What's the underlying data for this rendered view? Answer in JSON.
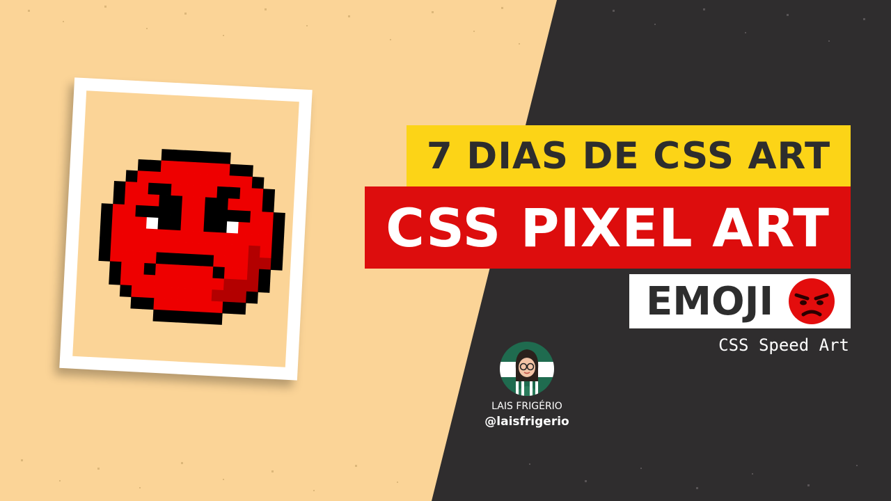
{
  "banner": {
    "series_title": "7 DIAS DE CSS ART",
    "main_title": "CSS PIXEL ART",
    "topic": "EMOJI",
    "subtitle": "CSS Speed Art"
  },
  "author": {
    "name": "LAIS FRIGÉRIO",
    "handle": "@laisfrigerio"
  },
  "colors": {
    "peach": "#fbd497",
    "dark": "#2f2d2e",
    "yellow": "#fcd417",
    "red": "#dd0d0d",
    "face_red": "#ee0000",
    "face_shadow": "#b30000",
    "avatar_green": "#1f6b4f"
  },
  "icons": {
    "pixel_art": "angry-face-pixel-art",
    "topic_emoji": "angry-face-emoji"
  }
}
